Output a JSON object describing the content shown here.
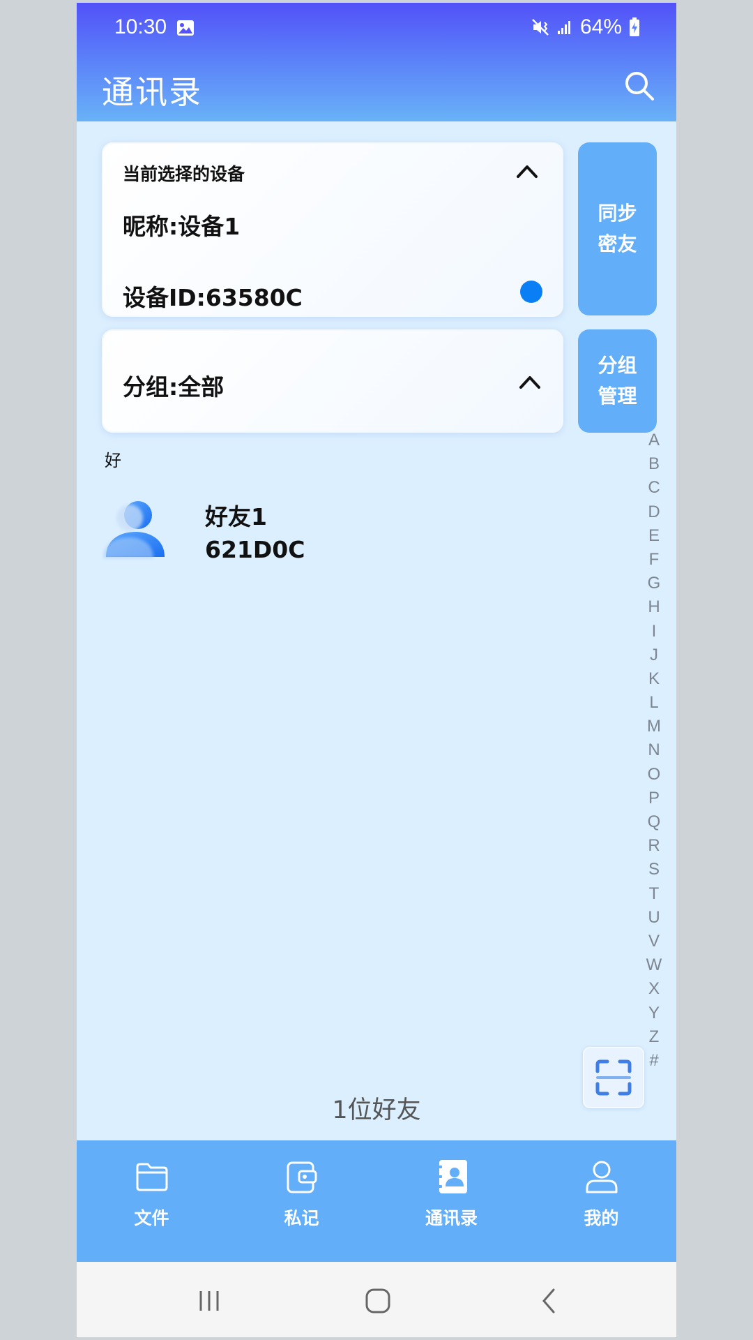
{
  "status_bar": {
    "time": "10:30",
    "battery": "64%",
    "icons": [
      "image-icon",
      "mute-vibrate-icon",
      "signal-icon",
      "battery-charging-icon"
    ]
  },
  "header": {
    "title": "通讯录",
    "search_icon": "search-icon"
  },
  "device_card": {
    "title": "当前选择的设备",
    "nickname": "昵称:设备1",
    "device_id": "设备ID:63580C",
    "status_color": "#0a7ff5"
  },
  "group_card": {
    "label": "分组:全部"
  },
  "side_buttons": {
    "sync_line1": "同步",
    "sync_line2": "密友",
    "group_line1": "分组",
    "group_line2": "管理"
  },
  "contacts": {
    "section": "好",
    "items": [
      {
        "name": "好友1",
        "id": "621D0C"
      }
    ],
    "count_label": "1位好友"
  },
  "alpha_index": [
    "A",
    "B",
    "C",
    "D",
    "E",
    "F",
    "G",
    "H",
    "I",
    "J",
    "K",
    "L",
    "M",
    "N",
    "O",
    "P",
    "Q",
    "R",
    "S",
    "T",
    "U",
    "V",
    "W",
    "X",
    "Y",
    "Z",
    "#"
  ],
  "tabbar": {
    "tabs": [
      {
        "label": "文件",
        "icon": "folder-icon"
      },
      {
        "label": "私记",
        "icon": "wallet-icon"
      },
      {
        "label": "通讯录",
        "icon": "contacts-icon"
      },
      {
        "label": "我的",
        "icon": "profile-icon"
      }
    ],
    "active": "通讯录"
  },
  "colors": {
    "header_top": "#5351f8",
    "accent": "#63aef8",
    "background": "#dcefff"
  }
}
